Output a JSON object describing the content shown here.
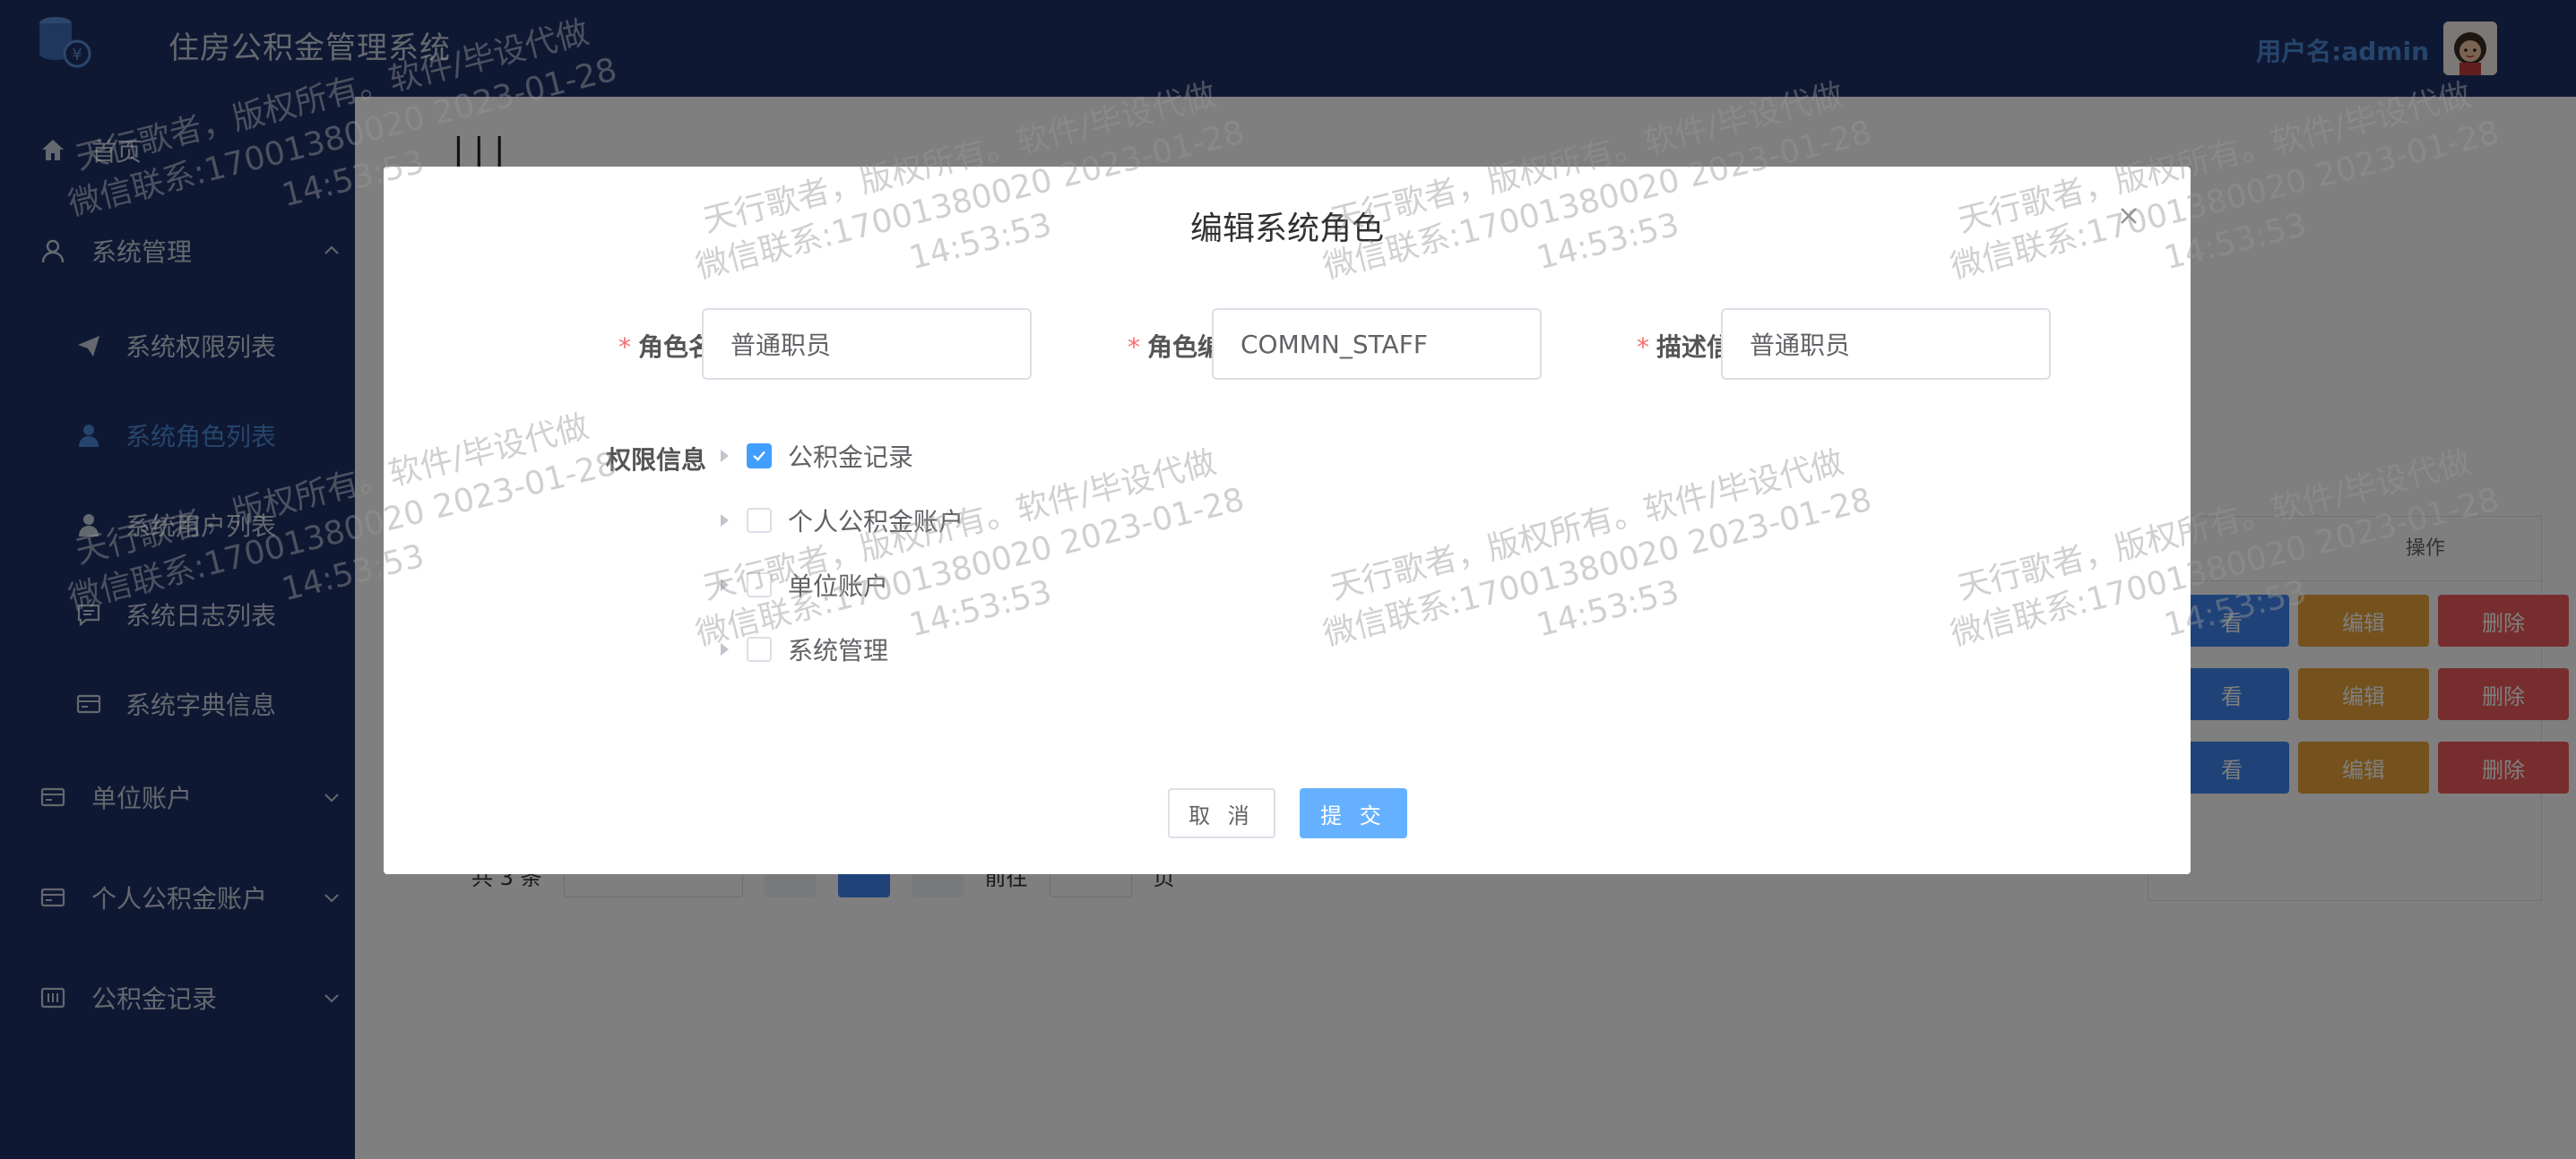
{
  "header": {
    "title": "住房公积金管理系统",
    "user_label": "用户名:admin"
  },
  "sidebar": {
    "items": [
      {
        "label": "首页",
        "icon": "home-icon"
      },
      {
        "label": "系统管理",
        "icon": "user-icon",
        "expanded": true
      },
      {
        "label": "系统权限列表",
        "icon": "send-icon"
      },
      {
        "label": "系统角色列表",
        "icon": "user-icon",
        "active": true
      },
      {
        "label": "系统用户列表",
        "icon": "user-icon"
      },
      {
        "label": "系统日志列表",
        "icon": "message-icon"
      },
      {
        "label": "系统字典信息",
        "icon": "card-icon"
      },
      {
        "label": "单位账户",
        "icon": "card-icon"
      },
      {
        "label": "个人公积金账户",
        "icon": "card-icon"
      },
      {
        "label": "公积金记录",
        "icon": "chart-icon"
      }
    ]
  },
  "main": {
    "table_header_op": "操作",
    "row_actions": {
      "view": "看",
      "edit": "编辑",
      "delete": "删除"
    },
    "pager": {
      "total": "共 3 条",
      "goto": "前往",
      "page_unit": "页"
    }
  },
  "dialog": {
    "title": "编辑系统角色",
    "fields": {
      "role_name": {
        "label": "角色名称",
        "value": "普通职员"
      },
      "role_code": {
        "label": "角色编码",
        "value": "COMMN_STAFF"
      },
      "description": {
        "label": "描述信息",
        "value": "普通职员"
      }
    },
    "permissions_label": "权限信息",
    "tree": [
      {
        "label": "公积金记录",
        "checked": true
      },
      {
        "label": "个人公积金账户",
        "checked": false
      },
      {
        "label": "单位账户",
        "checked": false
      },
      {
        "label": "系统管理",
        "checked": false
      }
    ],
    "cancel_label": "取 消",
    "submit_label": "提 交"
  },
  "watermark": {
    "line1": "天行歌者，版权所有。软件/毕设代做",
    "line2": "微信联系:17001380020 2023-01-28",
    "line3": "14:53:53"
  },
  "colors": {
    "sidebar_bg": "#1f3166",
    "accent": "#409eff",
    "active_nav": "#4d8ad8",
    "submit_bg": "#66b1ff",
    "edit_btn": "#e8a33b",
    "delete_btn": "#ef5a5a",
    "required_mark": "#f56c6c"
  }
}
